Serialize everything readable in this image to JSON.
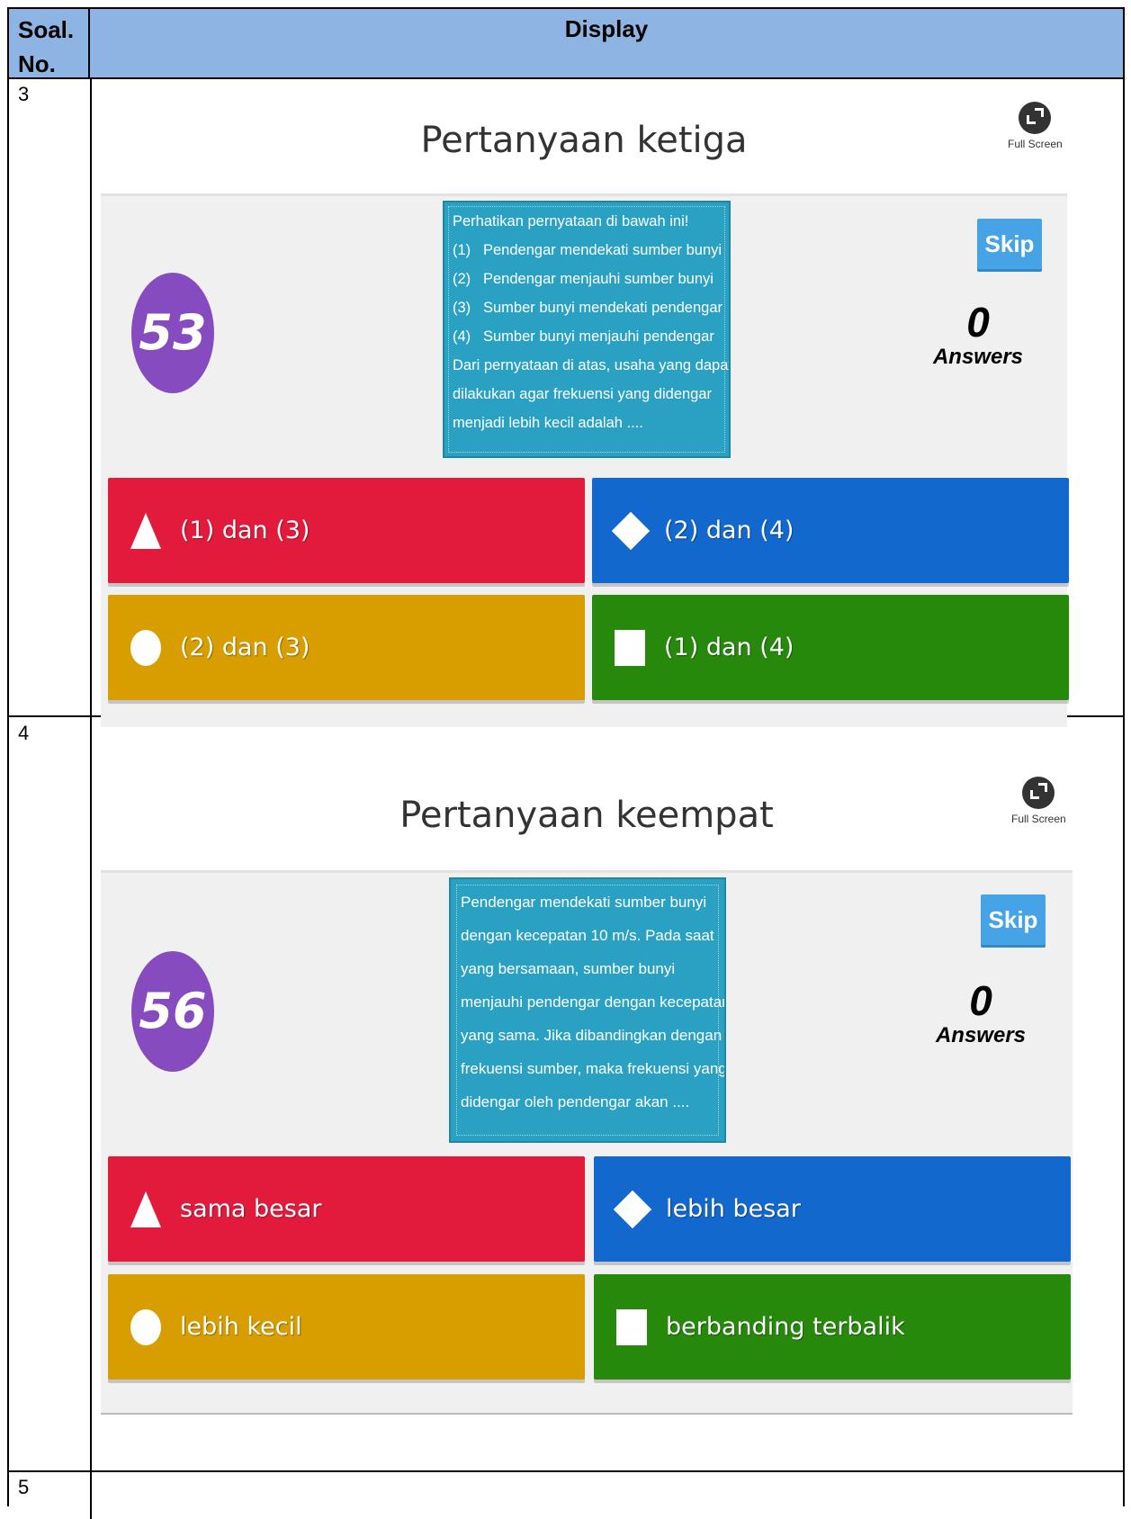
{
  "table": {
    "col1_header": "Soal. No.",
    "col2_header": "Display",
    "row_numbers": [
      "3",
      "4",
      "5"
    ]
  },
  "colors": {
    "header_bg": "#8eb4e3",
    "timer": "#864cbf",
    "answer_red": "#e21b3c",
    "answer_blue": "#1368ce",
    "answer_gold": "#d89e00",
    "answer_green": "#26890c",
    "skip": "#46a4e6",
    "question_box": "#2aa1c2"
  },
  "q3": {
    "title": "Pertanyaan ketiga",
    "fullscreen_icon": "fullscreen-icon",
    "fullscreen_label": "Full Screen",
    "timer": "53",
    "question_intro": "Perhatikan pernyataan di bawah ini!",
    "statements": [
      {
        "num": "(1)",
        "text": "Pendengar mendekati sumber bunyi"
      },
      {
        "num": "(2)",
        "text": "Pendengar menjauhi sumber bunyi"
      },
      {
        "num": "(3)",
        "text": "Sumber bunyi mendekati pendengar"
      },
      {
        "num": "(4)",
        "text": "Sumber bunyi menjauhi pendengar"
      }
    ],
    "question_lines": [
      "Dari pernyataan di atas, usaha yang dapat",
      "dilakukan agar frekuensi yang didengar",
      "menjadi lebih kecil adalah ...."
    ],
    "skip": "Skip",
    "answers_count": "0",
    "answers_label": "Answers",
    "answers": [
      {
        "shape": "triangle-icon",
        "label": "(1) dan (3)"
      },
      {
        "shape": "diamond-icon",
        "label": "(2) dan (4)"
      },
      {
        "shape": "circle-icon",
        "label": "(2) dan (3)"
      },
      {
        "shape": "square-icon",
        "label": "(1) dan (4)"
      }
    ]
  },
  "q4": {
    "title": "Pertanyaan keempat",
    "fullscreen_icon": "fullscreen-icon",
    "fullscreen_label": "Full Screen",
    "timer": "56",
    "question_lines": [
      "Pendengar mendekati sumber bunyi",
      "dengan kecepatan 10 m/s. Pada saat",
      "yang bersamaan, sumber bunyi",
      "menjauhi pendengar dengan kecepatan",
      "yang sama. Jika dibandingkan dengan",
      "frekuensi sumber, maka frekuensi yang",
      "didengar oleh pendengar akan ...."
    ],
    "skip": "Skip",
    "answers_count": "0",
    "answers_label": "Answers",
    "answers": [
      {
        "shape": "triangle-icon",
        "label": "sama besar"
      },
      {
        "shape": "diamond-icon",
        "label": "lebih besar"
      },
      {
        "shape": "circle-icon",
        "label": "lebih kecil"
      },
      {
        "shape": "square-icon",
        "label": "berbanding terbalik"
      }
    ]
  }
}
